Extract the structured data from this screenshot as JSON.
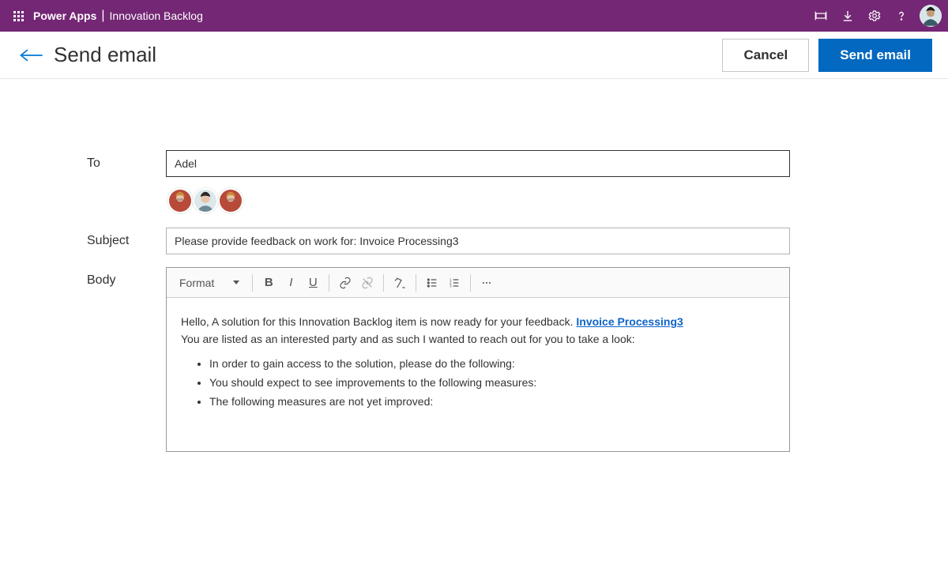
{
  "topbar": {
    "brand": "Power Apps",
    "separator": "|",
    "appname": "Innovation Backlog"
  },
  "header": {
    "title": "Send email",
    "cancel_label": "Cancel",
    "send_label": "Send email"
  },
  "form": {
    "to_label": "To",
    "to_value": "Adel",
    "subject_label": "Subject",
    "subject_value": "Please provide feedback on work for: Invoice Processing3",
    "body_label": "Body"
  },
  "toolbar": {
    "format": "Format"
  },
  "body_content": {
    "line1_prefix": "Hello, A solution for this Innovation Backlog item is now ready for your feedback. ",
    "line1_link": "Invoice Processing3",
    "line2": "You are listed as an interested party and as such I wanted to reach out for you to take a look:",
    "bullets": [
      "In order to gain access to the solution, please do the following:",
      "You should expect to see improvements to the following measures:",
      "The following measures are not yet improved:"
    ]
  },
  "icons": {
    "fit": "fit-icon",
    "download": "download-icon",
    "settings": "gear-icon",
    "help": "help-icon"
  }
}
